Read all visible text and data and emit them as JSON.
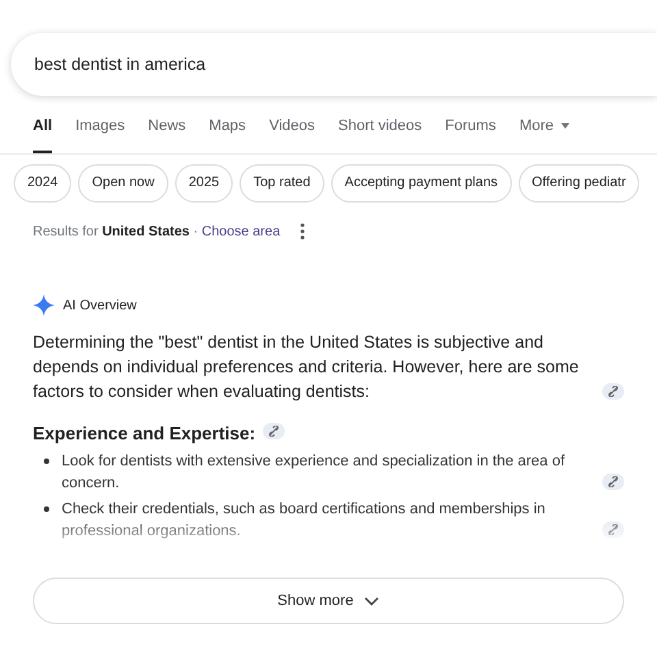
{
  "search": {
    "value": "best dentist in america"
  },
  "tabs": [
    {
      "label": "All",
      "selected": true
    },
    {
      "label": "Images",
      "selected": false
    },
    {
      "label": "News",
      "selected": false
    },
    {
      "label": "Maps",
      "selected": false
    },
    {
      "label": "Videos",
      "selected": false
    },
    {
      "label": "Short videos",
      "selected": false
    },
    {
      "label": "Forums",
      "selected": false
    },
    {
      "label": "More",
      "selected": false,
      "kind": "menu"
    }
  ],
  "chips": [
    "2024",
    "Open now",
    "2025",
    "Top rated",
    "Accepting payment plans",
    "Offering pediatr"
  ],
  "location": {
    "prefix": "Results for",
    "place": "United States",
    "separator": "·",
    "link": "Choose area"
  },
  "ai_overview": {
    "title": "AI Overview",
    "intro": "Determining the \"best\" dentist in the United States is subjective and depends on individual preferences and criteria. However, here are some factors to consider when evaluating dentists:",
    "heading": "Experience and Expertise:",
    "bullets": [
      {
        "text": "Look for dentists with extensive experience and specialization in the area of concern.",
        "faded": false
      },
      {
        "text": "Check their credentials, such as board certifications and memberships in professional organizations.",
        "faded": true
      }
    ],
    "show_more": "Show more"
  }
}
